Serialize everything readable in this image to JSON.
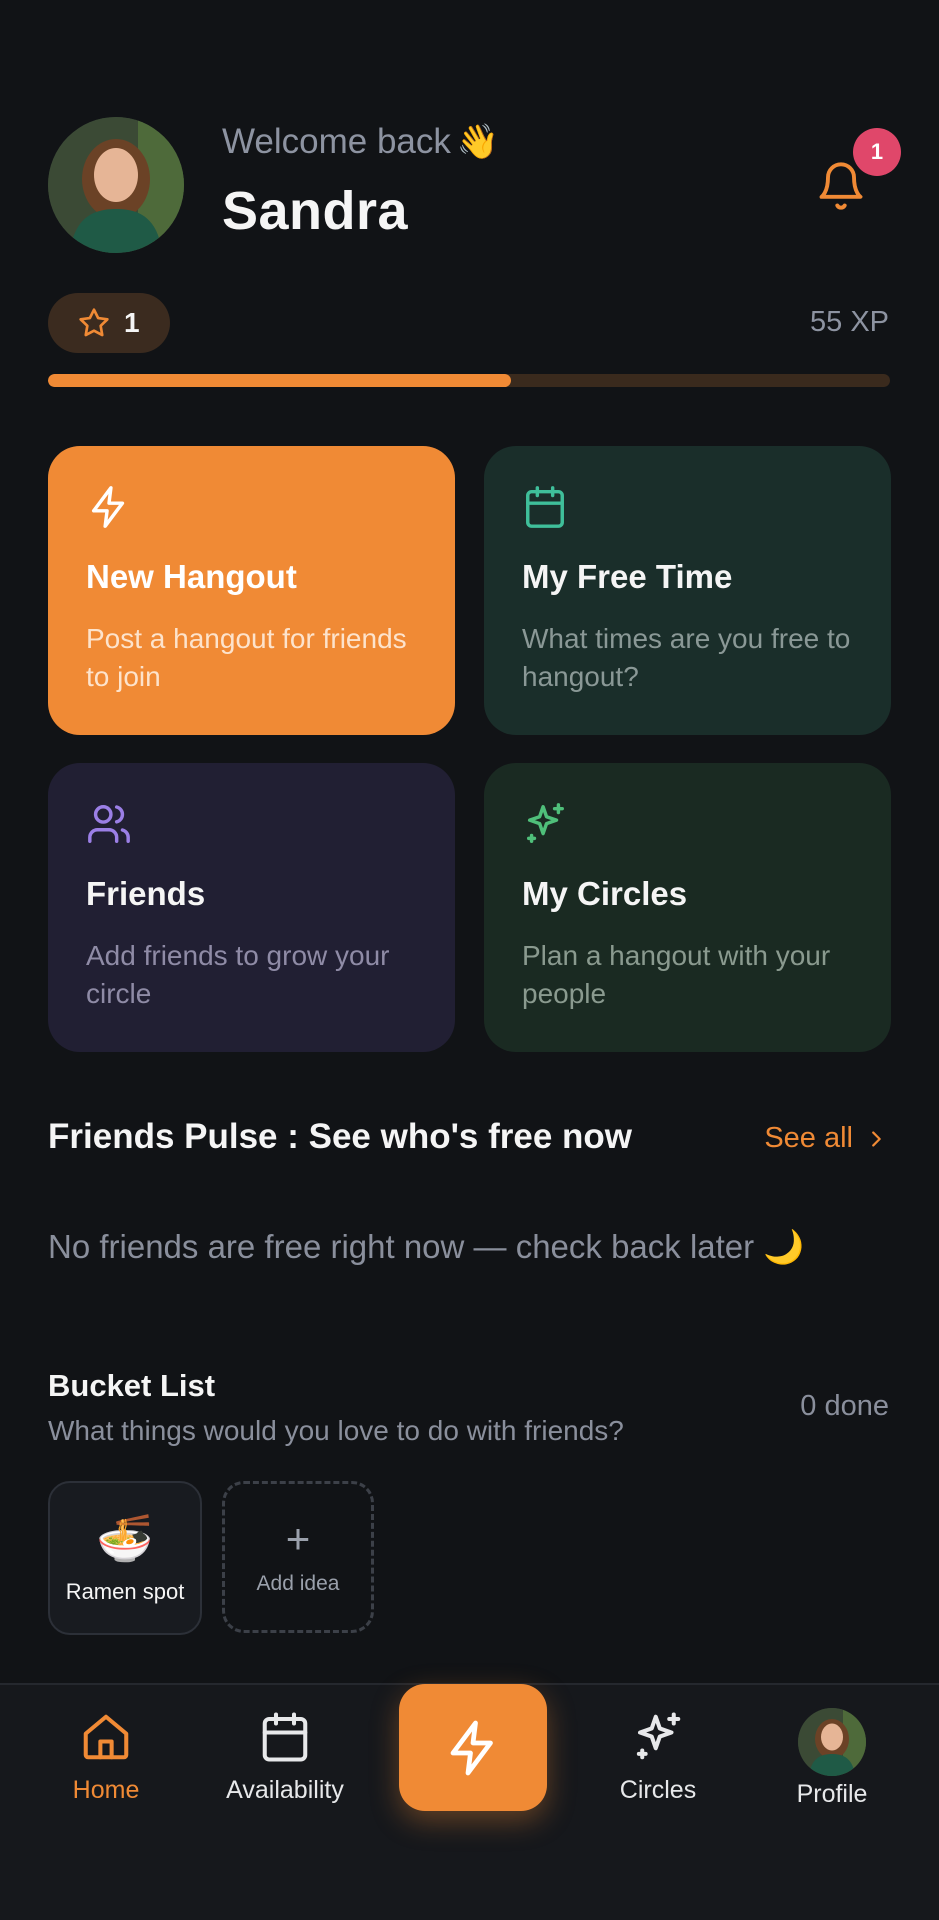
{
  "header": {
    "welcome": "Welcome back",
    "wave_emoji": "👋",
    "user_name": "Sandra",
    "notification_count": "1"
  },
  "progress": {
    "level": "1",
    "xp_label": "55 XP",
    "fill_fraction": 0.55
  },
  "cards": {
    "new_hangout": {
      "title": "New Hangout",
      "desc": "Post a hangout for friends to join",
      "icon": "lightning-icon"
    },
    "free_time": {
      "title": "My Free Time",
      "desc": "What times are you free to hangout?",
      "icon": "calendar-icon"
    },
    "friends": {
      "title": "Friends",
      "desc": "Add friends to grow your circle",
      "icon": "users-icon"
    },
    "circles": {
      "title": "My Circles",
      "desc": "Plan a hangout with your people",
      "icon": "sparkles-icon"
    }
  },
  "pulse": {
    "title": "Friends Pulse : See who's free now",
    "see_all": "See all",
    "empty": "No friends are free right now — check back later 🌙"
  },
  "bucket": {
    "title": "Bucket List",
    "subtitle": "What things would you love to do with friends?",
    "done": "0 done",
    "ideas": [
      {
        "emoji": "🍜",
        "label": "Ramen spot"
      }
    ],
    "add_label": "Add idea",
    "add_plus": "+"
  },
  "nav": {
    "home": "Home",
    "availability": "Availability",
    "circles": "Circles",
    "profile": "Profile"
  },
  "colors": {
    "accent": "#f08a35",
    "background": "#111316",
    "badge": "#e0476a"
  }
}
